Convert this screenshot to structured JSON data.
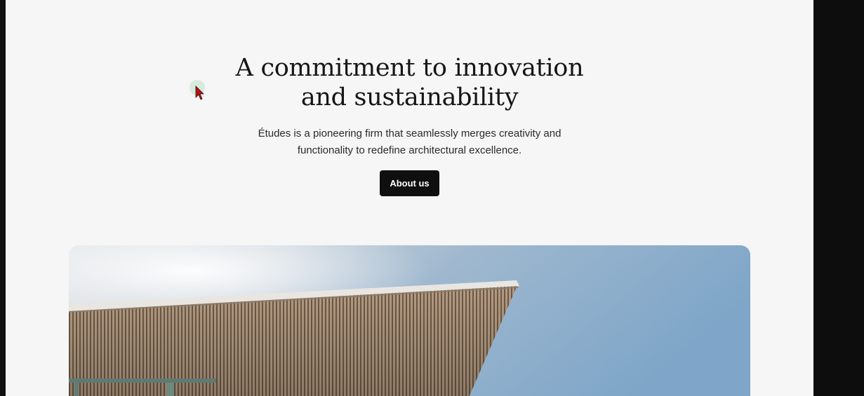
{
  "hero_section": {
    "headline_line1": "A commitment to innovation",
    "headline_line2": "and sustainability",
    "description_line1": "Études is a pioneering firm that seamlessly merges creativity and",
    "description_line2": "functionality to redefine architectural excellence.",
    "cta_label": "About us"
  },
  "hero_image": {
    "subject": "architectural roof canopy against blue sky"
  },
  "icons": {
    "cursor": "mouse-pointer-icon"
  },
  "colors": {
    "page_background": "#f5f6f5",
    "button_background": "#0f0f0f",
    "button_text": "#ffffff",
    "heading_text": "#151515",
    "sky": "#8fb0cf"
  }
}
